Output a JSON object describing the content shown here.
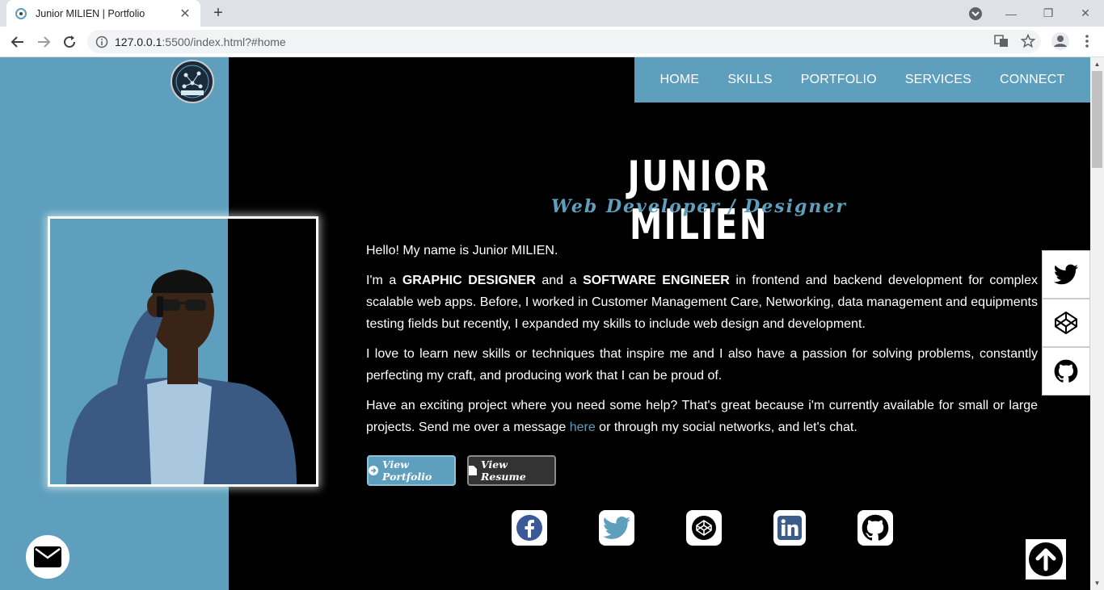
{
  "browser": {
    "tab_title": "Junior MILIEN | Portfolio",
    "url_host": "127.0.0.1",
    "url_rest": ":5500/index.html?#home"
  },
  "nav": {
    "items": [
      "HOME",
      "SKILLS",
      "PORTFOLIO",
      "SERVICES",
      "CONNECT"
    ]
  },
  "hero": {
    "name": "JUNIOR MILIEN",
    "role": "Web Developer / Designer"
  },
  "about": {
    "greeting": "Hello! My name is Junior MILIEN.",
    "p2_a": "I'm a ",
    "p2_b": "GRAPHIC DESIGNER",
    "p2_c": " and a ",
    "p2_d": "SOFTWARE ENGINEER",
    "p2_e": " in frontend and backend development for complex scalable web apps. Before, I worked in Customer Management Care, Networking, data management and equipments testing fields but recently, I expanded my skills to include web design and development.",
    "p3": "I love to learn new skills or techniques that inspire me and I also have a passion for solving problems, constantly perfecting my craft, and producing work that I can be proud of.",
    "p4_a": "Have an exciting project where you need some help? That's great because i'm currently available for small or large projects. Send me over a message ",
    "p4_link": "here",
    "p4_b": " or through my social networks, and let's chat."
  },
  "buttons": {
    "portfolio": "View Portfolio",
    "resume": "View Resume"
  },
  "social_icons": [
    "facebook-icon",
    "twitter-icon",
    "codepen-icon",
    "linkedin-icon",
    "github-icon"
  ],
  "side_social_icons": [
    "twitter-icon",
    "codepen-icon",
    "github-icon"
  ],
  "colors": {
    "accent": "#5e9fbd",
    "background": "#000000",
    "facebook": "#3b5998",
    "twitter": "#5e9fbd",
    "linkedin": "#3b5b8a"
  }
}
